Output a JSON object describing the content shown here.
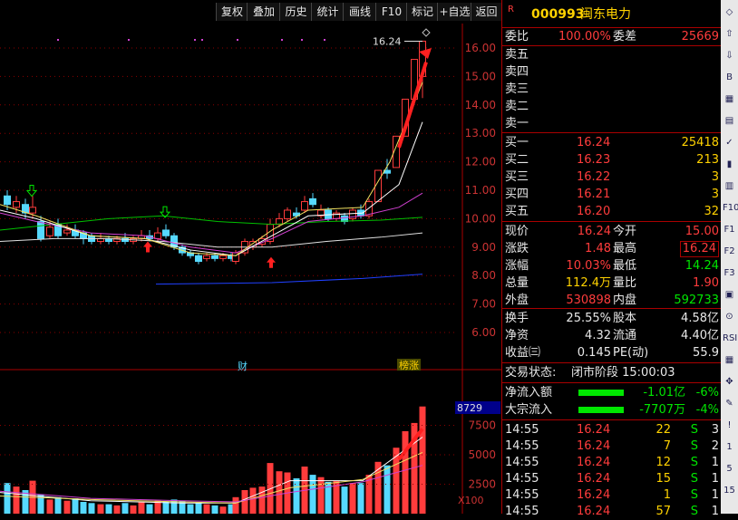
{
  "toolbar": {
    "items": [
      "复权",
      "叠加",
      "历史",
      "统计",
      "画线",
      "F10",
      "标记",
      "+自选",
      "返回"
    ]
  },
  "stock": {
    "marker": "R",
    "code": "000993",
    "name": "闽东电力"
  },
  "weibi": {
    "label1": "委比",
    "value1": "100.00%",
    "label2": "委差",
    "value2": "25669"
  },
  "sell_labels": [
    "卖五",
    "卖四",
    "卖三",
    "卖二",
    "卖一"
  ],
  "buy": [
    {
      "label": "买一",
      "price": "16.24",
      "vol": "25418"
    },
    {
      "label": "买二",
      "price": "16.23",
      "vol": "213"
    },
    {
      "label": "买三",
      "price": "16.22",
      "vol": "3"
    },
    {
      "label": "买四",
      "price": "16.21",
      "vol": "3"
    },
    {
      "label": "买五",
      "price": "16.20",
      "vol": "32"
    }
  ],
  "quote": [
    {
      "l1": "现价",
      "v1": "16.24",
      "l2": "今开",
      "v2": "15.00"
    },
    {
      "l1": "涨跌",
      "v1": "1.48",
      "l2": "最高",
      "v2": "16.24"
    },
    {
      "l1": "涨幅",
      "v1": "10.03%",
      "l2": "最低",
      "v2": "14.24"
    },
    {
      "l1": "总量",
      "v1": "112.4万",
      "l2": "量比",
      "v2": "1.90"
    },
    {
      "l1": "外盘",
      "v1": "530898",
      "l2": "内盘",
      "v2": "592733"
    }
  ],
  "fund": [
    {
      "l1": "换手",
      "v1": "25.55%",
      "l2": "股本",
      "v2": "4.58亿"
    },
    {
      "l1": "净资",
      "v1": "4.32",
      "l2": "流通",
      "v2": "4.40亿"
    },
    {
      "l1": "收益㈢",
      "v1": "0.145",
      "l2": "PE(动)",
      "v2": "55.9"
    }
  ],
  "status": {
    "label": "交易状态:",
    "value": "闭市阶段 15:00:03"
  },
  "flow": [
    {
      "label": "净流入额",
      "value": "-1.01亿",
      "pct": "-6%"
    },
    {
      "label": "大宗流入",
      "value": "-7707万",
      "pct": "-4%"
    }
  ],
  "ticks": [
    {
      "time": "14:55",
      "price": "16.24",
      "vol": "22",
      "side": "S",
      "n": "3"
    },
    {
      "time": "14:55",
      "price": "16.24",
      "vol": "7",
      "side": "S",
      "n": "2"
    },
    {
      "time": "14:55",
      "price": "16.24",
      "vol": "12",
      "side": "S",
      "n": "1"
    },
    {
      "time": "14:55",
      "price": "16.24",
      "vol": "15",
      "side": "S",
      "n": "1"
    },
    {
      "time": "14:55",
      "price": "16.24",
      "vol": "1",
      "side": "S",
      "n": "1"
    },
    {
      "time": "14:55",
      "price": "16.24",
      "vol": "57",
      "side": "S",
      "n": "1"
    }
  ],
  "price_axis": [
    "16.00",
    "15.00",
    "14.00",
    "13.00",
    "12.00",
    "11.00",
    "10.00",
    "9.00",
    "8.00",
    "7.00",
    "6.00"
  ],
  "high_label": "16.24",
  "vol_axis": [
    "7500",
    "5000",
    "2500"
  ],
  "vol_current": "8729",
  "vol_unit": "X100",
  "markers": {
    "cai": "财",
    "limit": "榜涨"
  },
  "iconbar": [
    "◇",
    "⇧",
    "⇩",
    "B",
    "▦",
    "▤",
    "✓",
    "▮",
    "▥",
    "F10",
    "F1",
    "F2",
    "F3",
    "▣",
    "⊙",
    "RSI",
    "▦",
    "✥",
    "✎",
    "!",
    "1",
    "5",
    "15"
  ]
}
